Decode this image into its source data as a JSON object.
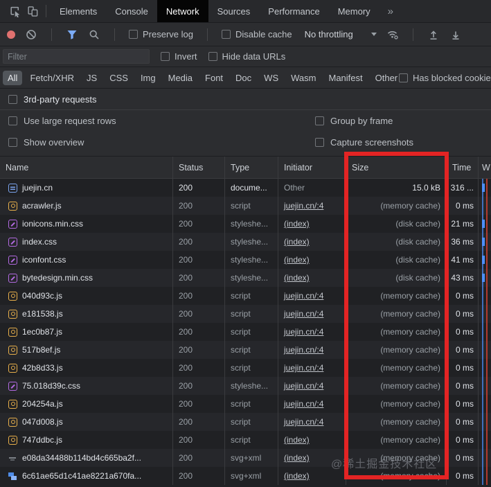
{
  "tabbar": {
    "tabs": [
      {
        "label": "Elements",
        "active": false
      },
      {
        "label": "Console",
        "active": false
      },
      {
        "label": "Network",
        "active": true
      },
      {
        "label": "Sources",
        "active": false
      },
      {
        "label": "Performance",
        "active": false
      },
      {
        "label": "Memory",
        "active": false
      }
    ],
    "more": "»"
  },
  "toolbar": {
    "preserve_log_label": "Preserve log",
    "disable_cache_label": "Disable cache",
    "throttling_value": "No throttling"
  },
  "filter": {
    "placeholder": "Filter",
    "invert_label": "Invert",
    "hide_data_urls_label": "Hide data URLs"
  },
  "pills": [
    "All",
    "Fetch/XHR",
    "JS",
    "CSS",
    "Img",
    "Media",
    "Font",
    "Doc",
    "WS",
    "Wasm",
    "Manifest",
    "Other"
  ],
  "active_pill": "All",
  "has_blocked_label": "Has blocked cookies",
  "settings": {
    "third_party_label": "3rd-party requests",
    "use_large_rows_label": "Use large request rows",
    "group_by_frame_label": "Group by frame",
    "show_overview_label": "Show overview",
    "capture_screenshots_label": "Capture screenshots"
  },
  "table": {
    "columns": [
      "Name",
      "Status",
      "Type",
      "Initiator",
      "Size",
      "Time",
      "W"
    ],
    "rows": [
      {
        "name": "juejin.cn",
        "icon": "document",
        "status": "200",
        "type": "docume...",
        "initiator": "Other",
        "link": false,
        "size": "15.0 kB",
        "time": "316 ...",
        "dim": false,
        "wbar": true
      },
      {
        "name": "acrawler.js",
        "icon": "script",
        "status": "200",
        "type": "script",
        "initiator": "juejin.cn/:4",
        "link": true,
        "size": "(memory cache)",
        "time": "0 ms",
        "dim": true,
        "wbar": false
      },
      {
        "name": "ionicons.min.css",
        "icon": "stylesheet",
        "status": "200",
        "type": "styleshe...",
        "initiator": "(index)",
        "link": true,
        "size": "(disk cache)",
        "time": "21 ms",
        "dim": true,
        "wbar": true
      },
      {
        "name": "index.css",
        "icon": "stylesheet",
        "status": "200",
        "type": "styleshe...",
        "initiator": "(index)",
        "link": true,
        "size": "(disk cache)",
        "time": "36 ms",
        "dim": true,
        "wbar": true
      },
      {
        "name": "iconfont.css",
        "icon": "stylesheet",
        "status": "200",
        "type": "styleshe...",
        "initiator": "(index)",
        "link": true,
        "size": "(disk cache)",
        "time": "41 ms",
        "dim": true,
        "wbar": true
      },
      {
        "name": "bytedesign.min.css",
        "icon": "stylesheet",
        "status": "200",
        "type": "styleshe...",
        "initiator": "(index)",
        "link": true,
        "size": "(disk cache)",
        "time": "43 ms",
        "dim": true,
        "wbar": true
      },
      {
        "name": "040d93c.js",
        "icon": "script",
        "status": "200",
        "type": "script",
        "initiator": "juejin.cn/:4",
        "link": true,
        "size": "(memory cache)",
        "time": "0 ms",
        "dim": true,
        "wbar": false
      },
      {
        "name": "e181538.js",
        "icon": "script",
        "status": "200",
        "type": "script",
        "initiator": "juejin.cn/:4",
        "link": true,
        "size": "(memory cache)",
        "time": "0 ms",
        "dim": true,
        "wbar": false
      },
      {
        "name": "1ec0b87.js",
        "icon": "script",
        "status": "200",
        "type": "script",
        "initiator": "juejin.cn/:4",
        "link": true,
        "size": "(memory cache)",
        "time": "0 ms",
        "dim": true,
        "wbar": false
      },
      {
        "name": "517b8ef.js",
        "icon": "script",
        "status": "200",
        "type": "script",
        "initiator": "juejin.cn/:4",
        "link": true,
        "size": "(memory cache)",
        "time": "0 ms",
        "dim": true,
        "wbar": false
      },
      {
        "name": "42b8d33.js",
        "icon": "script",
        "status": "200",
        "type": "script",
        "initiator": "juejin.cn/:4",
        "link": true,
        "size": "(memory cache)",
        "time": "0 ms",
        "dim": true,
        "wbar": false
      },
      {
        "name": "75.018d39c.css",
        "icon": "stylesheet",
        "status": "200",
        "type": "styleshe...",
        "initiator": "juejin.cn/:4",
        "link": true,
        "size": "(memory cache)",
        "time": "0 ms",
        "dim": true,
        "wbar": false
      },
      {
        "name": "204254a.js",
        "icon": "script",
        "status": "200",
        "type": "script",
        "initiator": "juejin.cn/:4",
        "link": true,
        "size": "(memory cache)",
        "time": "0 ms",
        "dim": true,
        "wbar": false
      },
      {
        "name": "047d008.js",
        "icon": "script",
        "status": "200",
        "type": "script",
        "initiator": "juejin.cn/:4",
        "link": true,
        "size": "(memory cache)",
        "time": "0 ms",
        "dim": true,
        "wbar": false
      },
      {
        "name": "747ddbc.js",
        "icon": "script",
        "status": "200",
        "type": "script",
        "initiator": "(index)",
        "link": true,
        "size": "(memory cache)",
        "time": "0 ms",
        "dim": true,
        "wbar": false
      },
      {
        "name": "e08da34488b114bd4c665ba2f...",
        "icon": "image-gray",
        "status": "200",
        "type": "svg+xml",
        "initiator": "(index)",
        "link": true,
        "size": "(memory cache)",
        "time": "0 ms",
        "dim": true,
        "wbar": false
      },
      {
        "name": "6c61ae65d1c41ae8221a670fa...",
        "icon": "image-blue",
        "status": "200",
        "type": "svg+xml",
        "initiator": "(index)",
        "link": true,
        "size": "(memory cache)",
        "time": "0 ms",
        "dim": true,
        "wbar": false
      }
    ]
  },
  "watermark": "@稀土掘金技术社区",
  "colors": {
    "accent_blue": "#7cacf8",
    "record_red": "#e0716f",
    "annotation_red": "#e32424",
    "doc_icon_blue": "#7ba4ee",
    "js_icon_yellow": "#e9b04b",
    "css_icon_purple": "#b36ae2",
    "waterfall_blue": "#4d90fe",
    "load_line_red": "#b33a2e"
  }
}
